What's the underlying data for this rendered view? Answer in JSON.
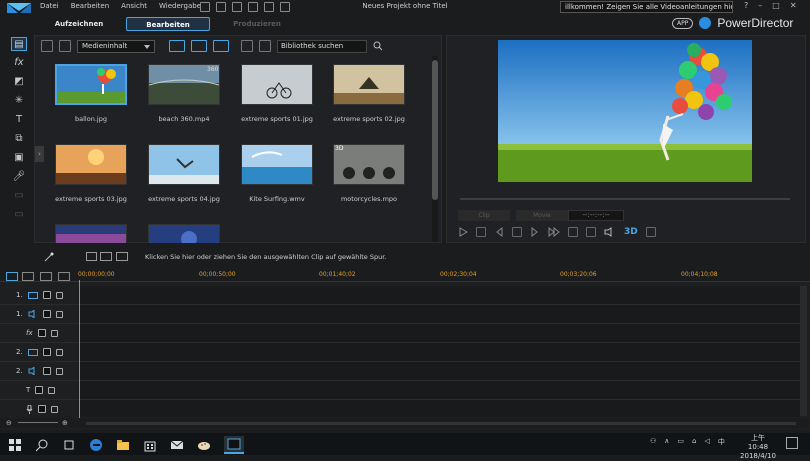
{
  "menu": [
    "Datei",
    "Bearbeiten",
    "Ansicht",
    "Wiedergabe"
  ],
  "window_title": "Neues Projekt ohne Titel",
  "notice": "illkommen! Zeigen Sie alle Videoanleitungen hier an!",
  "window_buttons": [
    "?",
    "–",
    "□",
    "✕"
  ],
  "modes": [
    {
      "label": "Aufzeichnen"
    },
    {
      "label": "Bearbeiten"
    },
    {
      "label": "Produzieren"
    }
  ],
  "brand": {
    "app": "APP",
    "name": "PowerDirector"
  },
  "library": {
    "dropdown": "Medieninhalt",
    "search_placeholder": "Bibliothek suchen",
    "items": [
      {
        "label": "ballon.jpg",
        "selected": true
      },
      {
        "label": "beach 360.mp4",
        "badge": "360"
      },
      {
        "label": "extreme sports 01.jpg"
      },
      {
        "label": "extreme sports 02.jpg"
      },
      {
        "label": "extreme sports 03.jpg"
      },
      {
        "label": "extreme sports 04.jpg"
      },
      {
        "label": "Kite Surfing.wmv"
      },
      {
        "label": "motorcycles.mpo",
        "badge": "3D"
      }
    ]
  },
  "preview": {
    "clip_label": "Clip",
    "movie_label": "Movie",
    "timecode": "--:--:--:--",
    "b3d": "3D"
  },
  "hint": "Klicken Sie hier oder ziehen Sie den ausgewählten Clip auf gewählte Spur.",
  "timeline": {
    "ruler": [
      "00;00;00;00",
      "00;00;50;00",
      "00;01;40;02",
      "00;02;30;04",
      "00;03;20;06",
      "00;04;10;08"
    ],
    "tracks": [
      {
        "num": "1.",
        "type": "video"
      },
      {
        "num": "1.",
        "type": "audio"
      },
      {
        "num": "",
        "type": "fx"
      },
      {
        "num": "2.",
        "type": "video"
      },
      {
        "num": "2.",
        "type": "audio"
      },
      {
        "num": "",
        "type": "title"
      },
      {
        "num": "",
        "type": "voice"
      }
    ]
  },
  "taskbar": {
    "time": "上午 10:48",
    "date": "2018/4/10",
    "ime": "中"
  },
  "colors": {
    "accent": "#4aa5e0",
    "ruler": "#e0a030"
  }
}
